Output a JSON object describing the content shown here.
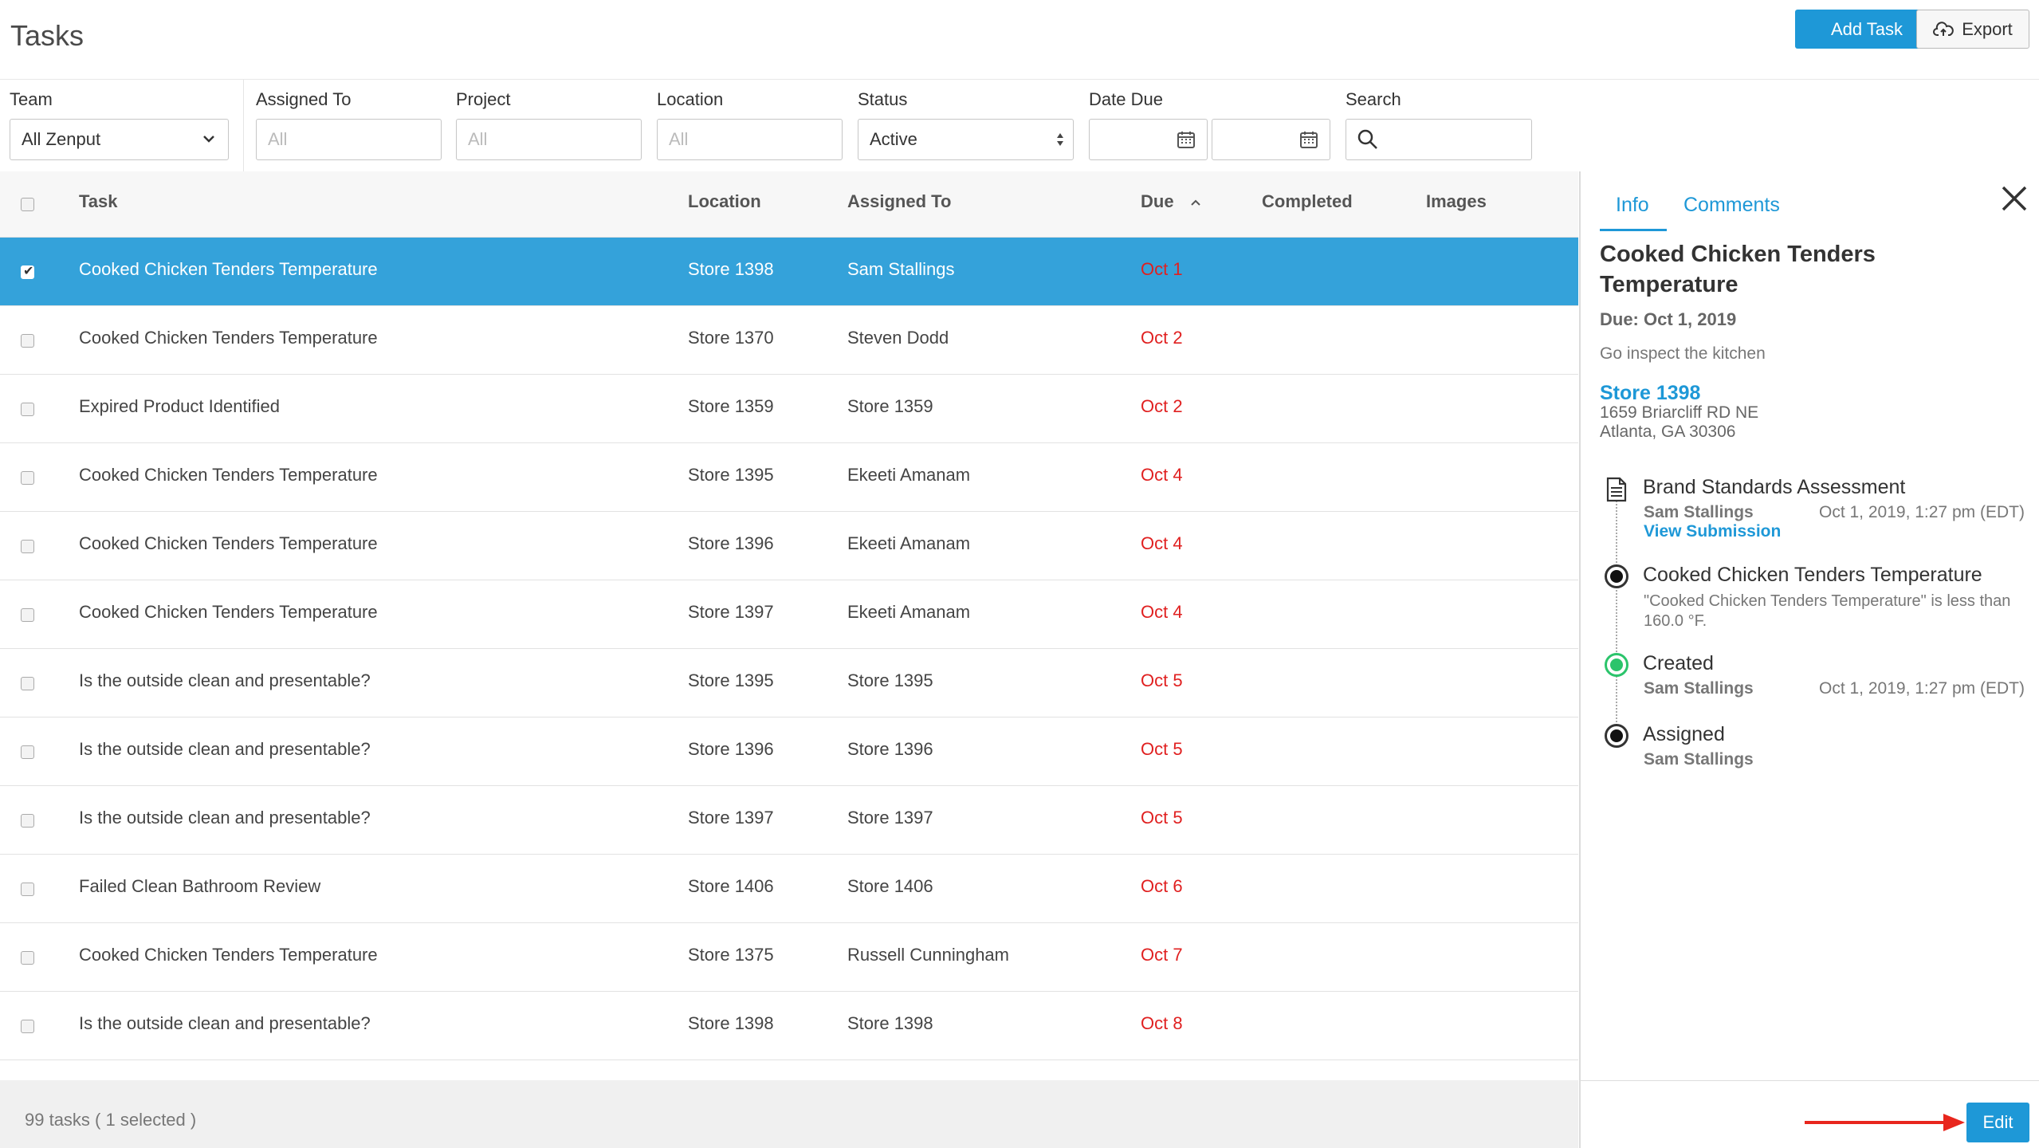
{
  "header": {
    "title": "Tasks",
    "add_task_label": "Add Task",
    "export_label": "Export"
  },
  "filters": {
    "team": {
      "label": "Team",
      "value": "All Zenput"
    },
    "assigned_to": {
      "label": "Assigned To",
      "placeholder": "All"
    },
    "project": {
      "label": "Project",
      "placeholder": "All"
    },
    "location": {
      "label": "Location",
      "placeholder": "All"
    },
    "status": {
      "label": "Status",
      "value": "Active"
    },
    "date_due": {
      "label": "Date Due"
    },
    "search": {
      "label": "Search"
    }
  },
  "table": {
    "columns": {
      "task": "Task",
      "location": "Location",
      "assigned_to": "Assigned To",
      "due": "Due",
      "completed": "Completed",
      "images": "Images"
    },
    "rows": [
      {
        "task": "Cooked Chicken Tenders Temperature",
        "location": "Store 1398",
        "assigned_to": "Sam Stallings",
        "due": "Oct 1"
      },
      {
        "task": "Cooked Chicken Tenders Temperature",
        "location": "Store 1370",
        "assigned_to": "Steven Dodd",
        "due": "Oct 2"
      },
      {
        "task": "Expired Product Identified",
        "location": "Store 1359",
        "assigned_to": "Store 1359",
        "due": "Oct 2"
      },
      {
        "task": "Cooked Chicken Tenders Temperature",
        "location": "Store 1395",
        "assigned_to": "Ekeeti Amanam",
        "due": "Oct 4"
      },
      {
        "task": "Cooked Chicken Tenders Temperature",
        "location": "Store 1396",
        "assigned_to": "Ekeeti Amanam",
        "due": "Oct 4"
      },
      {
        "task": "Cooked Chicken Tenders Temperature",
        "location": "Store 1397",
        "assigned_to": "Ekeeti Amanam",
        "due": "Oct 4"
      },
      {
        "task": "Is the outside clean and presentable?",
        "location": "Store 1395",
        "assigned_to": "Store 1395",
        "due": "Oct 5"
      },
      {
        "task": "Is the outside clean and presentable?",
        "location": "Store 1396",
        "assigned_to": "Store 1396",
        "due": "Oct 5"
      },
      {
        "task": "Is the outside clean and presentable?",
        "location": "Store 1397",
        "assigned_to": "Store 1397",
        "due": "Oct 5"
      },
      {
        "task": "Failed Clean Bathroom Review",
        "location": "Store 1406",
        "assigned_to": "Store 1406",
        "due": "Oct 6"
      },
      {
        "task": "Cooked Chicken Tenders Temperature",
        "location": "Store 1375",
        "assigned_to": "Russell Cunningham",
        "due": "Oct 7"
      },
      {
        "task": "Is the outside clean and presentable?",
        "location": "Store 1398",
        "assigned_to": "Store 1398",
        "due": "Oct 8"
      }
    ],
    "footer": "99 tasks ( 1 selected )"
  },
  "panel": {
    "tabs": {
      "info": "Info",
      "comments": "Comments"
    },
    "title": "Cooked Chicken Tenders Temperature",
    "due": "Due: Oct 1, 2019",
    "description": "Go inspect the kitchen",
    "store": "Store 1398",
    "address_line1": "1659 Briarcliff RD NE",
    "address_line2": "Atlanta, GA 30306",
    "timeline": [
      {
        "title": "Brand Standards Assessment",
        "user": "Sam Stallings",
        "date": "Oct 1, 2019, 1:27 pm (EDT)",
        "link": "View Submission"
      },
      {
        "title": "Cooked Chicken Tenders Temperature",
        "note": "\"Cooked Chicken Tenders Temperature\" is less than 160.0 °F."
      },
      {
        "title": "Created",
        "user": "Sam Stallings",
        "date": "Oct 1, 2019, 1:27 pm (EDT)"
      },
      {
        "title": "Assigned",
        "user": "Sam Stallings"
      }
    ],
    "edit_label": "Edit"
  },
  "colors": {
    "accent": "#1e98d7",
    "selected_row": "#34a2da",
    "due_red": "#e02020",
    "created_green": "#2bc46b",
    "arrow_red": "#e8261d"
  },
  "icons": [
    "chevron-down-icon",
    "sort-arrows-icon",
    "calendar-icon",
    "search-icon",
    "cloud-upload-icon",
    "sort-asc-icon",
    "close-icon",
    "document-icon",
    "arrow-right-icon"
  ]
}
